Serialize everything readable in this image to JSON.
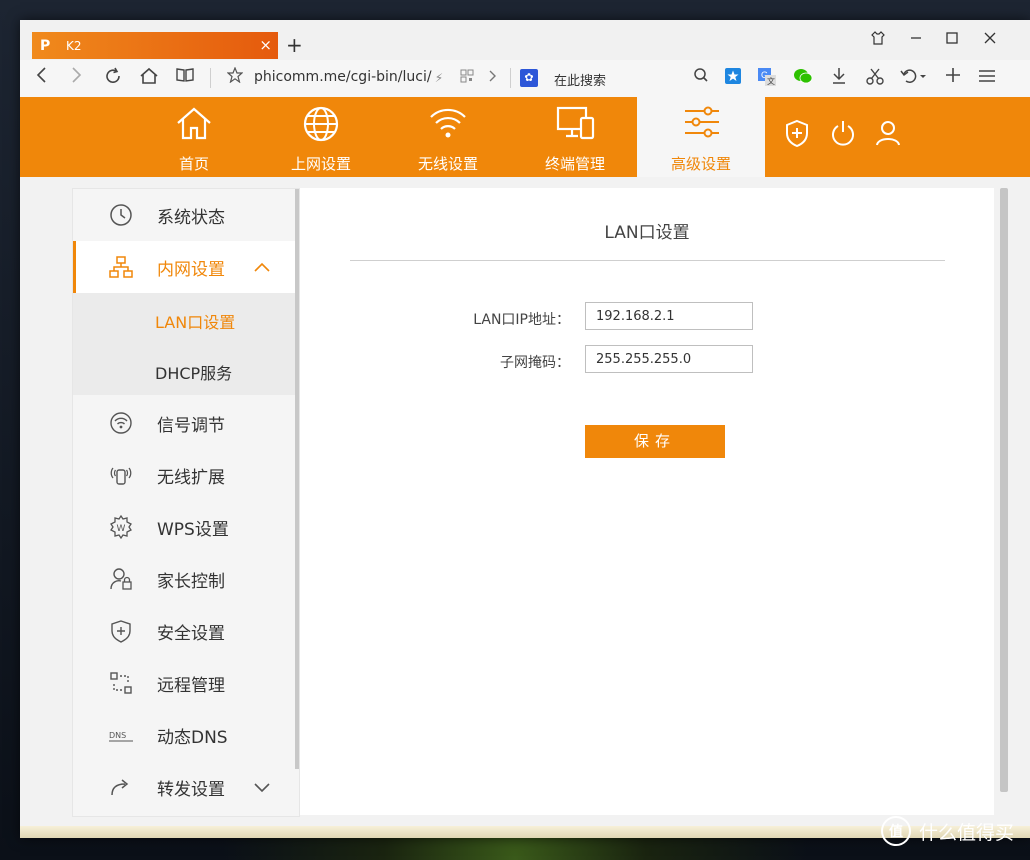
{
  "browser": {
    "tab_title": "K2",
    "tab_logo": "P",
    "tab_close": "×",
    "new_tab": "+",
    "url": "phicomm.me/cgi-bin/luci/",
    "search_placeholder": "在此搜索",
    "search_engine_icon": "paw-icon"
  },
  "router_menu": [
    {
      "label": "首页",
      "icon": "home-icon"
    },
    {
      "label": "上网设置",
      "icon": "globe-icon"
    },
    {
      "label": "无线设置",
      "icon": "wifi-icon"
    },
    {
      "label": "终端管理",
      "icon": "devices-icon"
    },
    {
      "label": "高级设置",
      "icon": "sliders-icon",
      "active": true
    }
  ],
  "sidebar": {
    "items": [
      {
        "label": "系统状态",
        "icon": "clock-icon"
      },
      {
        "label": "内网设置",
        "icon": "network-icon",
        "expanded": true
      },
      {
        "label": "信号调节",
        "icon": "signal-icon"
      },
      {
        "label": "无线扩展",
        "icon": "extender-icon"
      },
      {
        "label": "WPS设置",
        "icon": "wps-icon"
      },
      {
        "label": "家长控制",
        "icon": "parent-control-icon"
      },
      {
        "label": "安全设置",
        "icon": "shield-plus-icon"
      },
      {
        "label": "远程管理",
        "icon": "remote-icon"
      },
      {
        "label": "动态DNS",
        "icon": "dns-icon"
      },
      {
        "label": "转发设置",
        "icon": "forward-icon"
      }
    ],
    "subitems": [
      {
        "label": "LAN口设置",
        "active": true
      },
      {
        "label": "DHCP服务"
      }
    ],
    "dns_badge": "DNS",
    "wps_badge": "W"
  },
  "main": {
    "title": "LAN口设置",
    "fields": [
      {
        "label": "LAN口IP地址：",
        "value": "192.168.2.1"
      },
      {
        "label": "子网掩码：",
        "value": "255.255.255.0"
      }
    ],
    "save_label": "保存"
  },
  "watermark": {
    "text": "什么值得买",
    "logo": "值"
  },
  "colors": {
    "accent": "#f0870a",
    "tab": "#e55a0d"
  }
}
